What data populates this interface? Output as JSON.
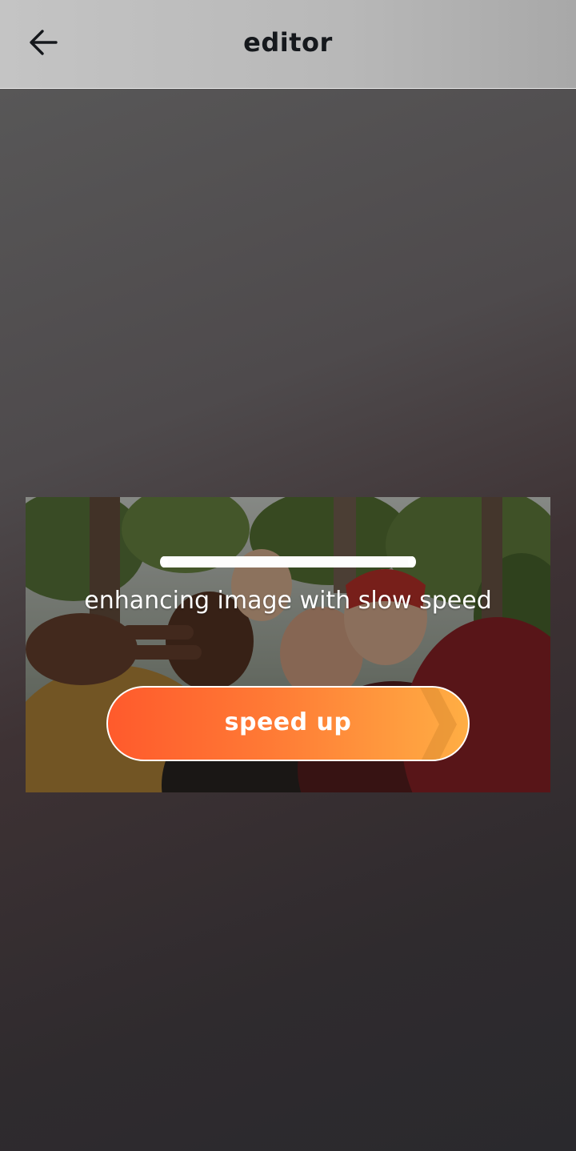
{
  "appbar": {
    "title": "editor",
    "back_icon": "arrow-left-icon"
  },
  "enhance": {
    "status_text": "enhancing image with slow speed",
    "progress": 1.0,
    "speed_button_label": "speed up"
  },
  "colors": {
    "button_start": "#ff5a2c",
    "button_end": "#ffae44",
    "title": "#15181c"
  }
}
